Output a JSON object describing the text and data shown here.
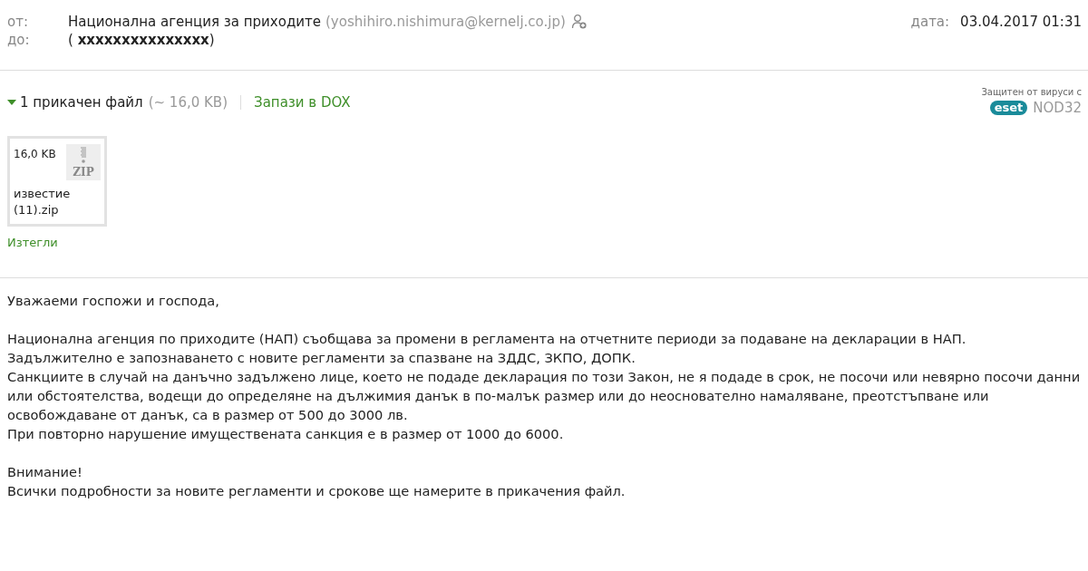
{
  "header": {
    "from_label": "от:",
    "from_name": "Национална агенция за приходите",
    "from_email": "(yoshihiro.nishimura@kernelj.co.jp)",
    "to_label": "до:",
    "to_value": "( **xxxxxxxxxxxxxxx**)",
    "date_label": "дата:",
    "date": "03.04.2017 01:31"
  },
  "attachments": {
    "expanded": true,
    "summary": "1 прикачен файл",
    "total_size": "(~ 16,0 KB)",
    "save_link": "Запази в DOX",
    "antivirus_note": "Защитен от вируси с",
    "antivirus_logo": "eset",
    "antivirus_product": "NOD32",
    "files": [
      {
        "size": "16,0 KB",
        "type_label": "ZIP",
        "name": "известие (11).zip"
      }
    ],
    "download_link": "Изтегли"
  },
  "body": [
    [
      "Уважаеми госпожи и господа,"
    ],
    [
      "Национална агенция по приходите (НАП) съобщава за промени в регламента на отчетните периоди за подаване на декларации в НАП.",
      "Задължително е запознаването с новите регламенти за спазване на ЗДДС, ЗКПО, ДОПК.",
      "Санкциите в случай на данъчно задължено лице, което не подаде декларация по този Закон, не я подаде в срок, не посочи или невярно посочи данни или обстоятелства, водещи до определяне на дължимия данък в по-малък размер или до неоснователно намаляване, преотстъпване или освобождаване от данък, са в размер от 500 до 3000 лв.",
      "При повторно нарушение имуществената санкция е в размер от 1000 до 6000."
    ],
    [
      "Внимание!",
      "Всички подробности за новите регламенти и срокове ще намерите в прикачения файл."
    ]
  ]
}
